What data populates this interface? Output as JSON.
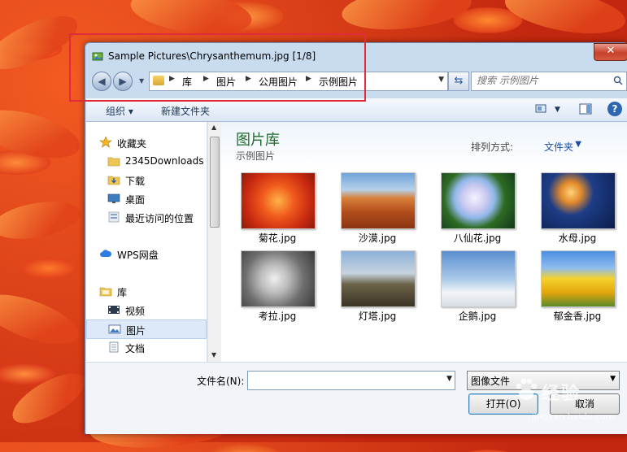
{
  "window": {
    "title": "Sample Pictures\\Chrysanthemum.jpg [1/8]",
    "close_label": "✕"
  },
  "nav": {
    "breadcrumbs": [
      "库",
      "图片",
      "公用图片",
      "示例图片"
    ]
  },
  "search": {
    "placeholder": "搜索 示例图片"
  },
  "toolbar": {
    "organize_label": "组织 ▾",
    "new_folder_label": "新建文件夹",
    "help_label": "?"
  },
  "sidebar": {
    "items": [
      {
        "label": "收藏夹",
        "icon": "star-icon",
        "group": true
      },
      {
        "label": "2345Downloads",
        "icon": "folder-icon",
        "group": false
      },
      {
        "label": "下载",
        "icon": "download-folder-icon",
        "group": false
      },
      {
        "label": "桌面",
        "icon": "desktop-icon",
        "group": false
      },
      {
        "label": "最近访问的位置",
        "icon": "recent-places-icon",
        "group": false
      },
      {
        "label": "WPS网盘",
        "icon": "cloud-icon",
        "group": true
      },
      {
        "label": "库",
        "icon": "library-icon",
        "group": true
      },
      {
        "label": "视频",
        "icon": "video-icon",
        "group": false
      },
      {
        "label": "图片",
        "icon": "pictures-icon",
        "group": false,
        "selected": true
      },
      {
        "label": "文档",
        "icon": "documents-icon",
        "group": false
      }
    ]
  },
  "main": {
    "library_title": "图片库",
    "library_subtitle": "示例图片",
    "arrange_label": "排列方式:",
    "arrange_value": "文件夹",
    "files": [
      {
        "name": "菊花.jpg",
        "thumb": "chrysanthemum"
      },
      {
        "name": "沙漠.jpg",
        "thumb": "desert"
      },
      {
        "name": "八仙花.jpg",
        "thumb": "hydrangeas"
      },
      {
        "name": "水母.jpg",
        "thumb": "jellyfish"
      },
      {
        "name": "考拉.jpg",
        "thumb": "koala"
      },
      {
        "name": "灯塔.jpg",
        "thumb": "lighthouse"
      },
      {
        "name": "企鹅.jpg",
        "thumb": "penguins"
      },
      {
        "name": "郁金香.jpg",
        "thumb": "tulips"
      }
    ]
  },
  "footer": {
    "filename_label": "文件名(N):",
    "filename_value": "",
    "filetype_value": "图像文件",
    "open_label": "打开(O)",
    "cancel_label": "取消"
  },
  "watermark": {
    "text": "经验",
    "url": "jingyan.baidu.com"
  },
  "colors": {
    "annotation_box": "#e02b3a",
    "library_title": "#1e6b2c",
    "link_blue": "#1a4f9e"
  }
}
